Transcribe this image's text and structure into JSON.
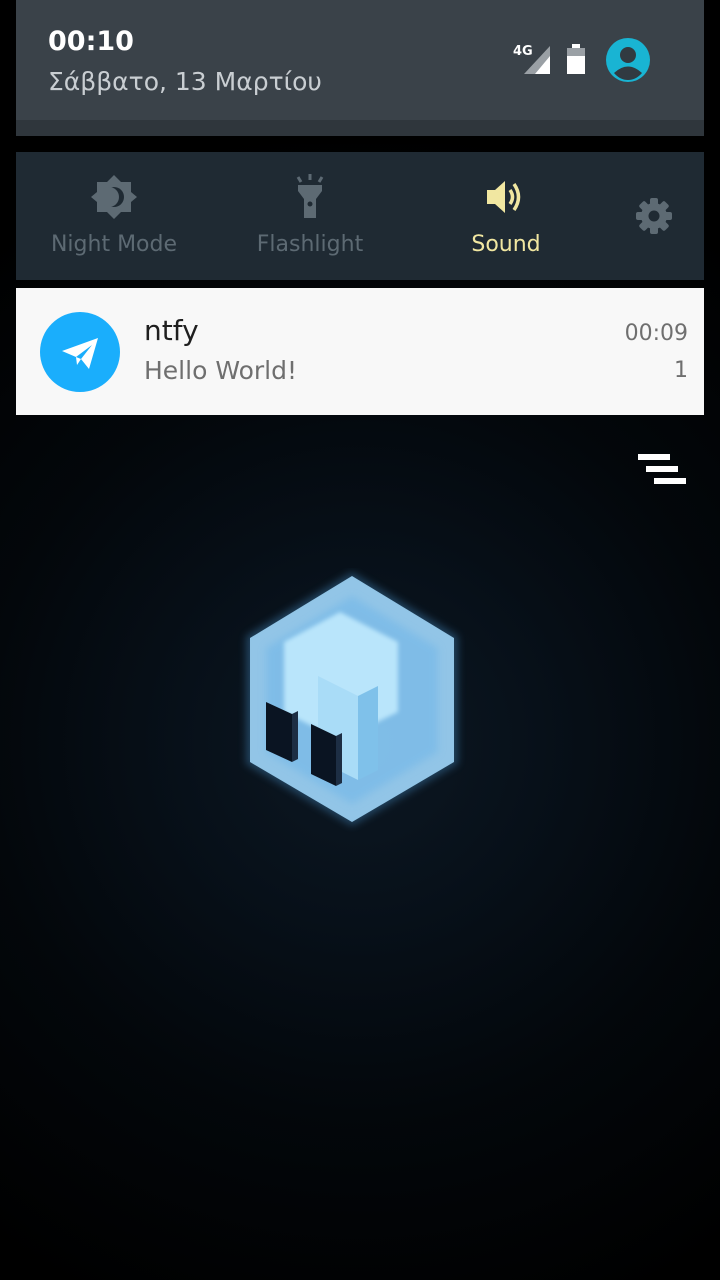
{
  "status_bar": {
    "time": "00:10",
    "date": "Σάββατο, 13 Μαρτίου",
    "network_type": "4G",
    "signal_icon": "signal-icon",
    "battery_icon": "battery-icon",
    "user_icon": "user-avatar-icon"
  },
  "quick_settings": {
    "tiles": [
      {
        "label": "Night Mode",
        "icon": "night-mode-icon",
        "active": false
      },
      {
        "label": "Flashlight",
        "icon": "flashlight-icon",
        "active": false
      },
      {
        "label": "Sound",
        "icon": "sound-icon",
        "active": true
      }
    ],
    "settings_icon": "gear-icon"
  },
  "notification": {
    "app_name": "ntfy",
    "message": "Hello World!",
    "time": "00:09",
    "count": "1",
    "icon": "telegram-send-icon",
    "icon_color": "#1aaefc"
  },
  "colors": {
    "header_bg": "#3a4249",
    "quick_panel_bg": "#1f2a33",
    "active_label": "#f1e7a1",
    "inactive_label": "#5d6a73",
    "accent": "#1aaefc"
  },
  "clear_all_icon": "clear-all-icon"
}
